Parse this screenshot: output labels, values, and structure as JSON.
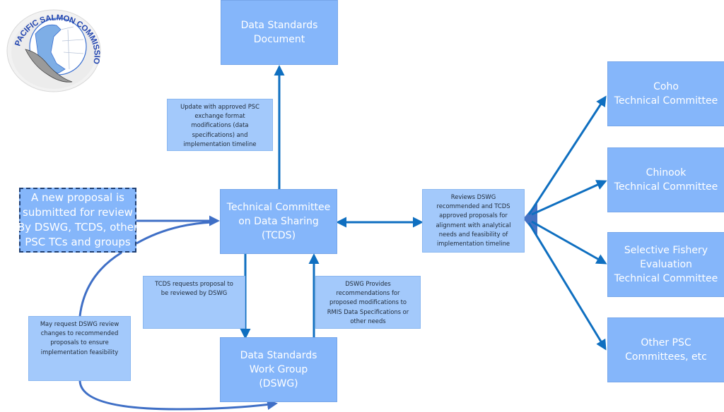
{
  "logo": {
    "text": "PACIFIC SALMON COMMISSION",
    "icon": "salmon-globe-logo"
  },
  "nodes": {
    "data_standards_document": {
      "lines": [
        "Data Standards",
        "Document"
      ]
    },
    "new_proposal": {
      "lines": [
        "A new proposal is",
        "submitted for review",
        "By DSWG, TCDS, other",
        "PSC TCs and groups"
      ]
    },
    "tcds": {
      "lines": [
        "Technical Committee",
        "on Data Sharing",
        "(TCDS)"
      ]
    },
    "dswg": {
      "lines": [
        "Data Standards",
        "Work Group",
        "(DSWG)"
      ]
    },
    "coho": {
      "lines": [
        "Coho",
        "Technical Committee"
      ]
    },
    "chinook": {
      "lines": [
        "Chinook",
        "Technical Committee"
      ]
    },
    "selective_fishery": {
      "lines": [
        "Selective Fishery",
        "Evaluation",
        "Technical Committee"
      ]
    },
    "other_psc": {
      "lines": [
        "Other PSC",
        "Committees, etc"
      ]
    }
  },
  "notes": {
    "update_document": {
      "lines": [
        "Update with approved PSC",
        "exchange format",
        "modifications (data",
        "specifications) and",
        "implementation timeline"
      ]
    },
    "reviews_proposals": {
      "lines": [
        "Reviews DSWG",
        "recommended and TCDS",
        "approved proposals for",
        "alignment with analytical",
        "needs and feasibility of",
        "implementation timeline"
      ]
    },
    "tcds_requests": {
      "lines": [
        "TCDS requests proposal to",
        "be reviewed by DSWG"
      ]
    },
    "dswg_provides": {
      "lines": [
        "DSWG Provides",
        "recommendations for",
        "proposed modifications to",
        "RMIS Data Specifications or",
        "other needs"
      ]
    },
    "may_request": {
      "lines": [
        "May request DSWG review",
        "changes to recommended",
        "proposals to ensure",
        "implementation feasibility"
      ]
    }
  },
  "colors": {
    "node_fill": "#85b6fa",
    "note_fill": "#a3c9fb",
    "arrow": "#0f6fc0",
    "curve_arrow": "#3f6fc6",
    "hub": "#4472c4"
  }
}
